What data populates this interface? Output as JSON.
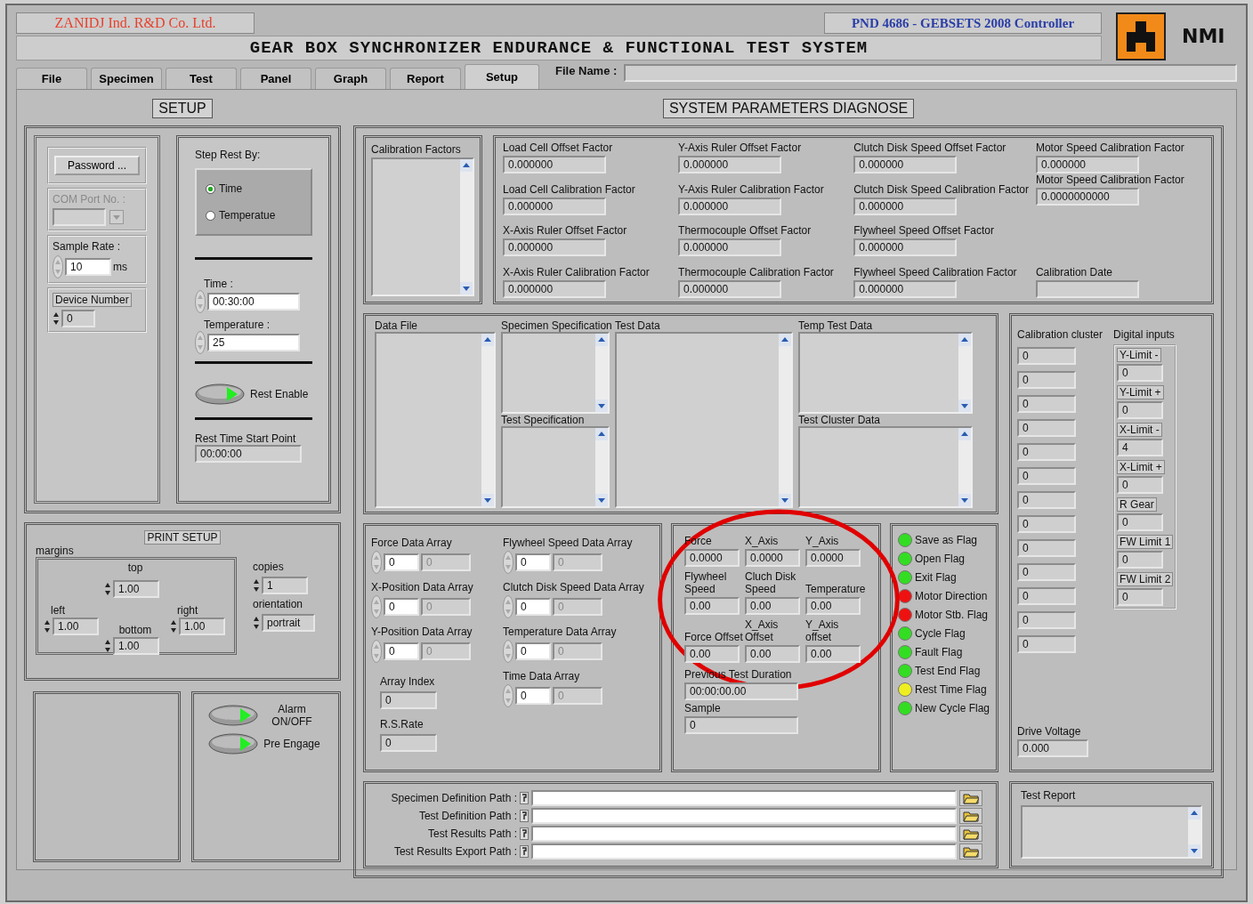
{
  "header": {
    "company": "ZANIDJ Ind. R&D Co. Ltd.",
    "controller": "PND 4686 - GEBSETS 2008 Controller",
    "brand": "NMI",
    "title": "GEAR BOX SYNCHRONIZER ENDURANCE & FUNCTIONAL TEST SYSTEM"
  },
  "tabs": [
    {
      "label": "File",
      "selected": false
    },
    {
      "label": "Specimen",
      "selected": false
    },
    {
      "label": "Test",
      "selected": false
    },
    {
      "label": "Panel",
      "selected": false
    },
    {
      "label": "Graph",
      "selected": false
    },
    {
      "label": "Report",
      "selected": false
    },
    {
      "label": "Setup",
      "selected": true
    }
  ],
  "file_name": {
    "label": "File Name :"
  },
  "setup": {
    "heading": "SETUP",
    "password_button": "Password ...",
    "com_port": {
      "label": "COM Port No. :",
      "disabled": true
    },
    "sample_rate": {
      "label": "Sample Rate :",
      "value": "10",
      "unit": "ms"
    },
    "device_number": {
      "label": "Device Number",
      "value": "0"
    },
    "step_rest": {
      "label": "Step Rest By:",
      "options": [
        {
          "label": "Time",
          "selected": true
        },
        {
          "label": "Temperatue",
          "selected": false
        }
      ]
    },
    "time": {
      "label": "Time :",
      "value": "00:30:00"
    },
    "temperature": {
      "label": "Temperature :",
      "value": "25"
    },
    "rest_enable": {
      "label": "Rest Enable",
      "on": true
    },
    "rest_time_start": {
      "label": "Rest Time Start Point",
      "value": "00:00:00"
    }
  },
  "print_setup": {
    "heading": "PRINT SETUP",
    "margins_label": "margins",
    "top": {
      "label": "top",
      "value": "1.00"
    },
    "left": {
      "label": "left",
      "value": "1.00"
    },
    "right": {
      "label": "right",
      "value": "1.00"
    },
    "bottom": {
      "label": "bottom",
      "value": "1.00"
    },
    "copies": {
      "label": "copies",
      "value": "1"
    },
    "orientation": {
      "label": "orientation",
      "value": "portrait"
    }
  },
  "switches": [
    {
      "label": "Alarm ON/OFF",
      "on": true
    },
    {
      "label": "Pre Engage",
      "on": true
    }
  ],
  "diagnose": {
    "heading": "SYSTEM PARAMETERS DIAGNOSE",
    "calibration_factors": {
      "label": "Calibration Factors"
    },
    "factor_columns": [
      [
        {
          "label": "Load Cell Offset Factor",
          "value": "0.000000"
        },
        {
          "label": "Load Cell Calibration Factor",
          "value": "0.000000"
        },
        {
          "label": "X-Axis Ruler Offset Factor",
          "value": "0.000000"
        },
        {
          "label": "X-Axis Ruler Calibration Factor",
          "value": "0.000000"
        }
      ],
      [
        {
          "label": "Y-Axis Ruler Offset Factor",
          "value": "0.000000"
        },
        {
          "label": "Y-Axis Ruler Calibration Factor",
          "value": "0.000000"
        },
        {
          "label": "Thermocouple Offset Factor",
          "value": "0.000000"
        },
        {
          "label": "Thermocouple Calibration Factor",
          "value": "0.000000"
        }
      ],
      [
        {
          "label": "Clutch Disk Speed Offset Factor",
          "value": "0.000000"
        },
        {
          "label": "Clutch Disk Speed Calibration Factor",
          "value": "0.000000"
        },
        {
          "label": "Flywheel Speed Offset Factor",
          "value": "0.000000"
        },
        {
          "label": "Flywheel Speed Calibration Factor",
          "value": "0.000000"
        }
      ],
      [
        {
          "label": "Motor Speed Calibration Factor",
          "value": "0.000000"
        },
        {
          "label": "Motor Speed Calibration Factor",
          "value": "0.0000000000"
        },
        {
          "label": "Calibration Date"
        }
      ]
    ],
    "data_lists": [
      [
        {
          "label": "Data File"
        }
      ],
      [
        {
          "label": "Specimen Specification"
        },
        {
          "label": "Test  Specification"
        }
      ],
      [
        {
          "label": "Test Data"
        }
      ],
      [
        {
          "label": "Temp Test Data"
        },
        {
          "label": "Test Cluster Data"
        }
      ]
    ],
    "arrays": [
      [
        {
          "label": "Force Data Array",
          "index": "0",
          "element": "0"
        },
        {
          "label": "X-Position Data Array",
          "index": "0",
          "element": "0"
        },
        {
          "label": "Y-Position Data Array",
          "index": "0",
          "element": "0"
        }
      ],
      [
        {
          "label": "Flywheel Speed Data Array",
          "index": "0",
          "element": "0"
        },
        {
          "label": "Clutch Disk Speed Data Array",
          "index": "0",
          "element": "0"
        },
        {
          "label": "Temperature Data Array",
          "index": "0",
          "element": "0"
        }
      ]
    ],
    "array_index": {
      "label": "Array Index",
      "value": "0"
    },
    "rs_rate": {
      "label": "R.S.Rate",
      "value": "0"
    },
    "time_array": {
      "label": "Time Data Array",
      "index": "0",
      "element": "0"
    },
    "readouts": [
      {
        "label": "Force",
        "value": "0.0000"
      },
      {
        "label": "X_Axis",
        "value": "0.0000"
      },
      {
        "label": "Y_Axis",
        "value": "0.0000"
      },
      {
        "label": "Flywheel Speed",
        "value": "0.00"
      },
      {
        "label": "Cluch Disk Speed",
        "value": "0.00"
      },
      {
        "label": "Temperature",
        "value": "0.00"
      },
      {
        "label": "Force Offset",
        "value": "0.00"
      },
      {
        "label": "X_Axis Offset",
        "value": "0.00"
      },
      {
        "label": "Y_Axis offset",
        "value": "0.00"
      }
    ],
    "previous_duration": {
      "label": "Previous Test Duration",
      "value": "00:00:00.00"
    },
    "sample": {
      "label": "Sample",
      "value": "0"
    },
    "flags": [
      {
        "label": "Save as Flag",
        "color": "#33dd22"
      },
      {
        "label": "Open Flag",
        "color": "#33dd22"
      },
      {
        "label": "Exit Flag",
        "color": "#33dd22"
      },
      {
        "label": "Motor Direction",
        "color": "#ee1111"
      },
      {
        "label": "Motor Stb. Flag",
        "color": "#ee1111"
      },
      {
        "label": "Cycle Flag",
        "color": "#33dd22"
      },
      {
        "label": "Fault Flag",
        "color": "#33dd22"
      },
      {
        "label": "Test End Flag",
        "color": "#33dd22"
      },
      {
        "label": "Rest Time Flag",
        "color": "#eeee22"
      },
      {
        "label": "New Cycle Flag",
        "color": "#33dd22"
      }
    ],
    "calibration_cluster": {
      "label": "Calibration cluster",
      "values": [
        "0",
        "0",
        "0",
        "0",
        "0",
        "0",
        "0",
        "0",
        "0",
        "0",
        "0",
        "0",
        "0"
      ]
    },
    "digital_inputs": {
      "label": "Digital inputs",
      "items": [
        {
          "label": "Y-Limit -",
          "value": "0"
        },
        {
          "label": "Y-Limit +",
          "value": "0"
        },
        {
          "label": "X-Limit -",
          "value": "4"
        },
        {
          "label": "X-Limit +",
          "value": "0"
        },
        {
          "label": "R Gear",
          "value": "0"
        },
        {
          "label": "FW Limit 1",
          "value": "0"
        },
        {
          "label": "FW Limit 2",
          "value": "0"
        }
      ]
    },
    "drive_voltage": {
      "label": "Drive Voltage",
      "value": "0.000"
    },
    "paths": [
      {
        "label": "Specimen Definition Path :"
      },
      {
        "label": "Test Definition Path :"
      },
      {
        "label": "Test Results Path :"
      },
      {
        "label": "Test Results Export Path :"
      }
    ],
    "test_report": {
      "label": "Test Report"
    }
  }
}
